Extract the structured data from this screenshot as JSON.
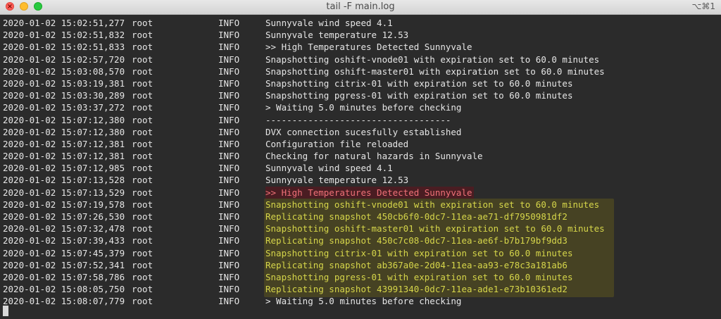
{
  "window": {
    "title": "tail -F main.log",
    "shortcut": "⌥⌘1"
  },
  "log_rows": [
    {
      "ts": "2020-01-02 15:02:51,277",
      "user": "root",
      "level": "INFO",
      "msg": "Sunnyvale wind speed 4.1"
    },
    {
      "ts": "2020-01-02 15:02:51,832",
      "user": "root",
      "level": "INFO",
      "msg": "Sunnyvale temperature 12.53"
    },
    {
      "ts": "2020-01-02 15:02:51,833",
      "user": "root",
      "level": "INFO",
      "msg": ">> High Temperatures Detected Sunnyvale"
    },
    {
      "ts": "2020-01-02 15:02:57,720",
      "user": "root",
      "level": "INFO",
      "msg": "Snapshotting oshift-vnode01 with expiration set to 60.0 minutes"
    },
    {
      "ts": "2020-01-02 15:03:08,570",
      "user": "root",
      "level": "INFO",
      "msg": "Snapshotting oshift-master01 with expiration set to 60.0 minutes"
    },
    {
      "ts": "2020-01-02 15:03:19,381",
      "user": "root",
      "level": "INFO",
      "msg": "Snapshotting citrix-01 with expiration set to 60.0 minutes"
    },
    {
      "ts": "2020-01-02 15:03:30,289",
      "user": "root",
      "level": "INFO",
      "msg": "Snapshotting pgress-01 with expiration set to 60.0 minutes"
    },
    {
      "ts": "2020-01-02 15:03:37,272",
      "user": "root",
      "level": "INFO",
      "msg": "> Waiting 5.0 minutes before checking"
    },
    {
      "ts": "2020-01-02 15:07:12,380",
      "user": "root",
      "level": "INFO",
      "msg": "-----------------------------------"
    },
    {
      "ts": "2020-01-02 15:07:12,380",
      "user": "root",
      "level": "INFO",
      "msg": "DVX connection sucesfully established"
    },
    {
      "ts": "2020-01-02 15:07:12,381",
      "user": "root",
      "level": "INFO",
      "msg": "Configuration file reloaded"
    },
    {
      "ts": "2020-01-02 15:07:12,381",
      "user": "root",
      "level": "INFO",
      "msg": "Checking for natural hazards in Sunnyvale"
    },
    {
      "ts": "2020-01-02 15:07:12,985",
      "user": "root",
      "level": "INFO",
      "msg": "Sunnyvale wind speed 4.1"
    },
    {
      "ts": "2020-01-02 15:07:13,528",
      "user": "root",
      "level": "INFO",
      "msg": "Sunnyvale temperature 12.53"
    },
    {
      "ts": "2020-01-02 15:07:13,529",
      "user": "root",
      "level": "INFO",
      "msg": ">> High Temperatures Detected Sunnyvale",
      "style": "alert"
    },
    {
      "ts": "2020-01-02 15:07:19,578",
      "user": "root",
      "level": "INFO",
      "msg": "Snapshotting oshift-vnode01 with expiration set to 60.0 minutes",
      "style": "hl"
    },
    {
      "ts": "2020-01-02 15:07:26,530",
      "user": "root",
      "level": "INFO",
      "msg": "Replicating snapshot 450cb6f0-0dc7-11ea-ae71-df7950981df2",
      "style": "hl"
    },
    {
      "ts": "2020-01-02 15:07:32,478",
      "user": "root",
      "level": "INFO",
      "msg": "Snapshotting oshift-master01 with expiration set to 60.0 minutes",
      "style": "hl"
    },
    {
      "ts": "2020-01-02 15:07:39,433",
      "user": "root",
      "level": "INFO",
      "msg": "Replicating snapshot 450c7c08-0dc7-11ea-ae6f-b7b179bf9dd3",
      "style": "hl"
    },
    {
      "ts": "2020-01-02 15:07:45,379",
      "user": "root",
      "level": "INFO",
      "msg": "Snapshotting citrix-01 with expiration set to 60.0 minutes",
      "style": "hl"
    },
    {
      "ts": "2020-01-02 15:07:52,341",
      "user": "root",
      "level": "INFO",
      "msg": "Replicating snapshot ab367a0e-2d04-11ea-aa93-e78c3a181ab6",
      "style": "hl"
    },
    {
      "ts": "2020-01-02 15:07:58,786",
      "user": "root",
      "level": "INFO",
      "msg": "Snapshotting pgress-01 with expiration set to 60.0 minutes",
      "style": "hl"
    },
    {
      "ts": "2020-01-02 15:08:05,750",
      "user": "root",
      "level": "INFO",
      "msg": "Replicating snapshot 43991340-0dc7-11ea-ade1-e73b10361ed2",
      "style": "hl"
    },
    {
      "ts": "2020-01-02 15:08:07,779",
      "user": "root",
      "level": "INFO",
      "msg": "> Waiting 5.0 minutes before checking"
    }
  ],
  "colors": {
    "background": "#2b2b2b",
    "text": "#e6e6e6",
    "alert_text": "#f07178",
    "highlight_text": "#d6d64a"
  }
}
